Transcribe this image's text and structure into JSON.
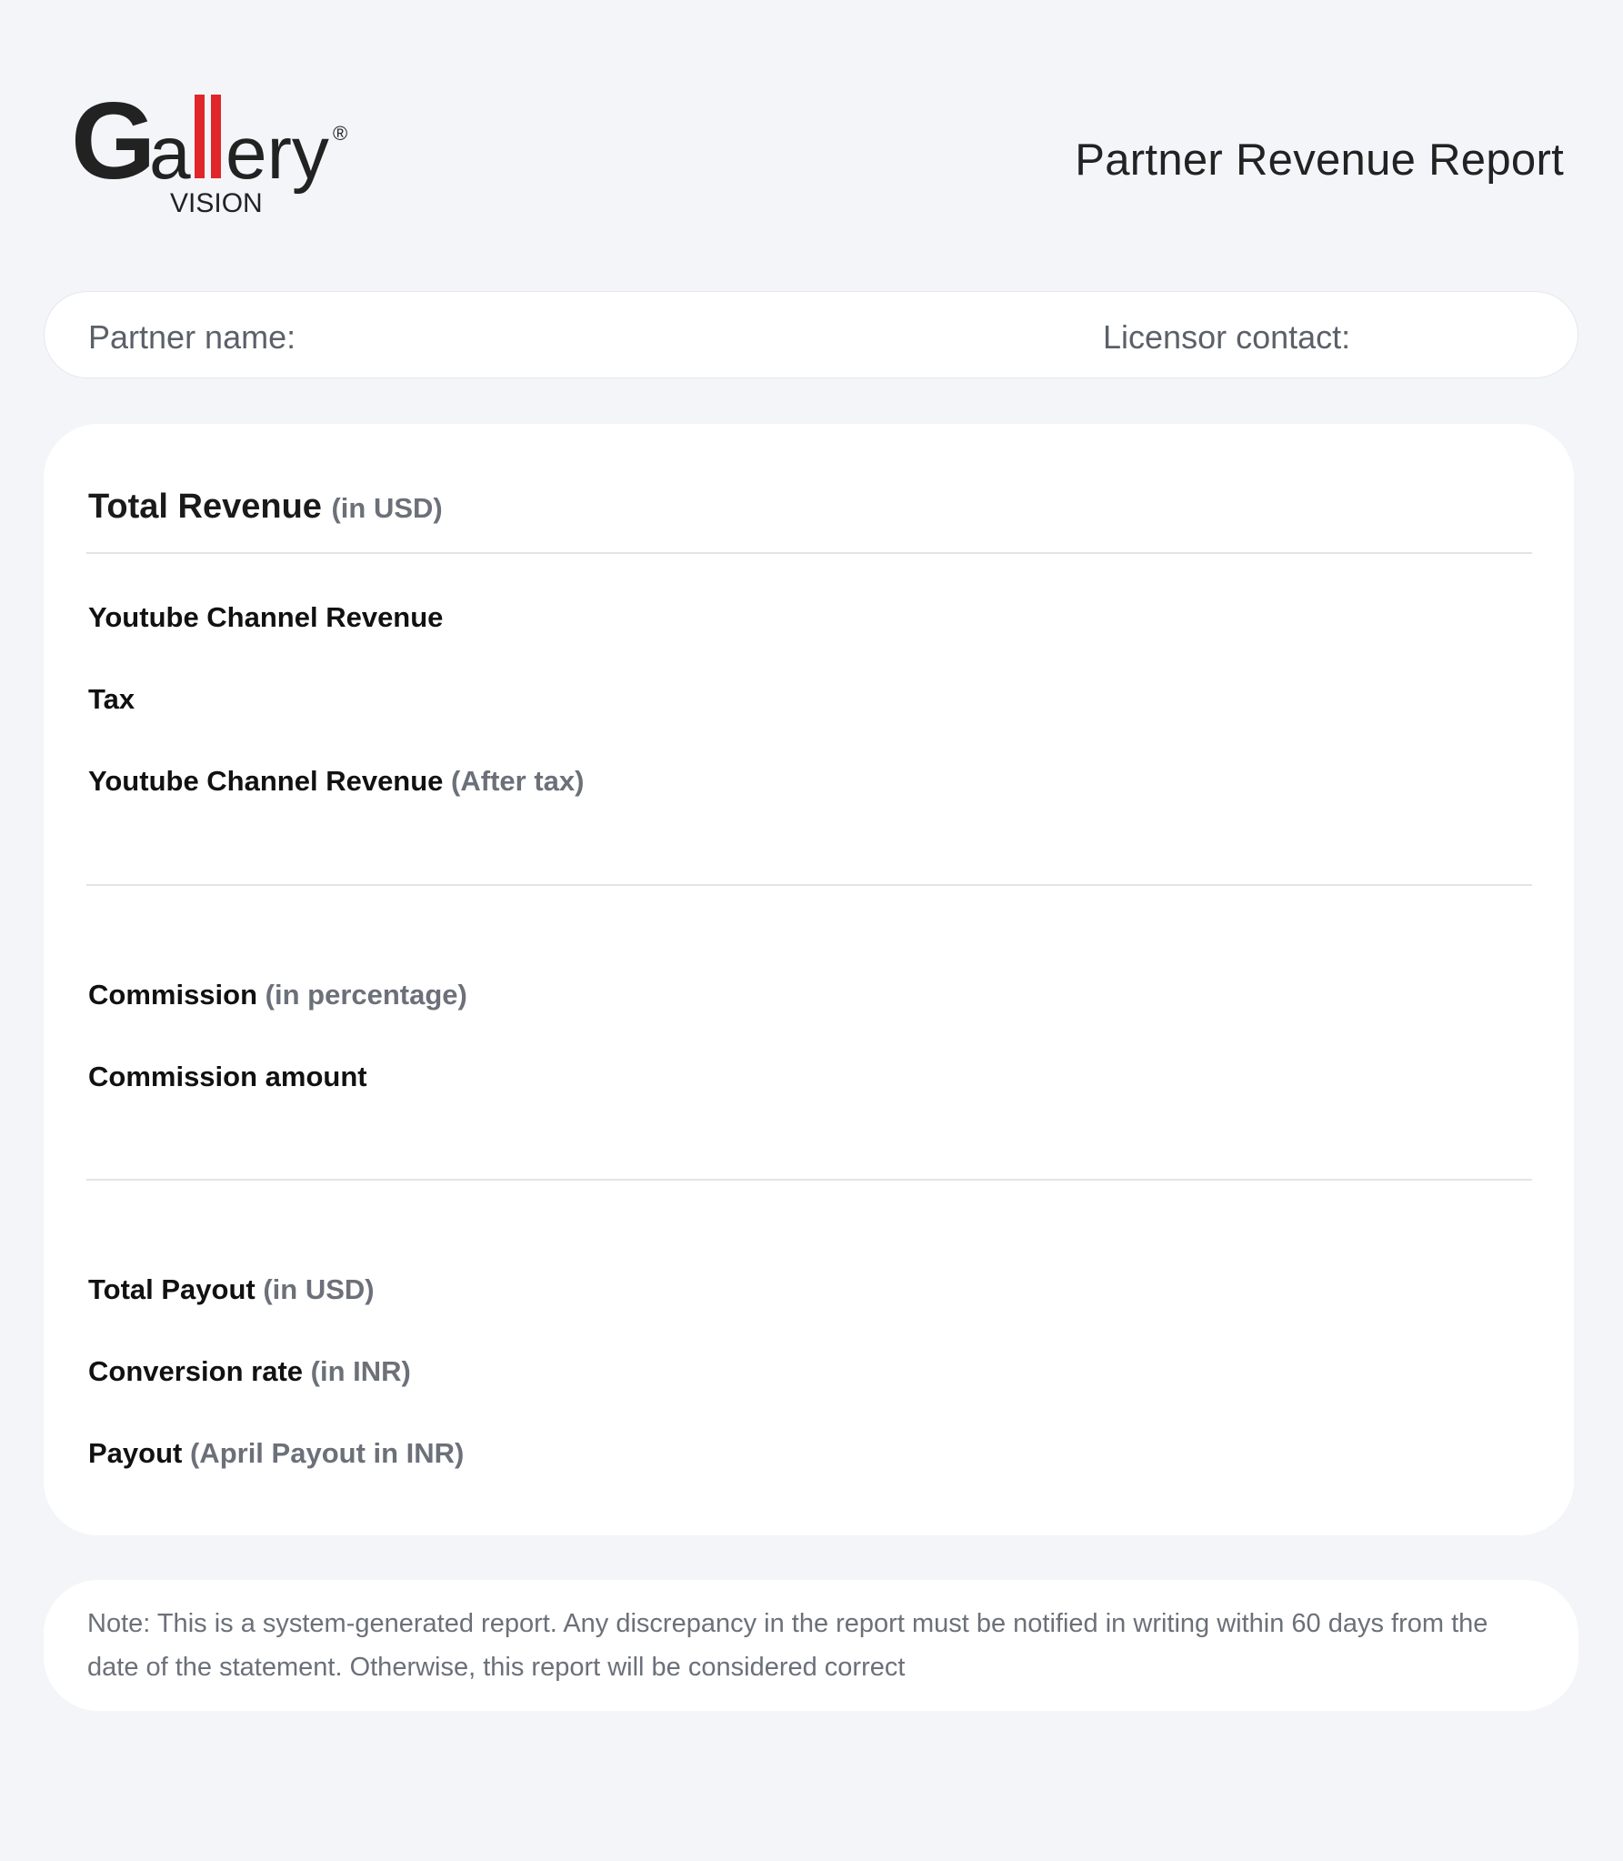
{
  "logo": {
    "wordmark": "Gallery",
    "registered": "®",
    "subtitle": "VISION",
    "colors": {
      "dark": "#222222",
      "accent": "#e0262b"
    }
  },
  "header": {
    "title": "Partner Revenue Report"
  },
  "info_bar": {
    "partner_label": "Partner name:",
    "licensor_label": "Licensor contact:"
  },
  "revenue_card": {
    "title": "Total Revenue",
    "title_unit": "(in USD)",
    "rows": [
      {
        "label": "Youtube Channel Revenue",
        "sub": ""
      },
      {
        "label": "Tax",
        "sub": ""
      },
      {
        "label": "Youtube Channel Revenue",
        "sub": "(After tax)"
      },
      {
        "label": "Commission",
        "sub": "(in percentage)"
      },
      {
        "label": "Commission amount",
        "sub": ""
      },
      {
        "label": "Total Payout",
        "sub": "(in USD)"
      },
      {
        "label": "Conversion rate",
        "sub": "(in INR)"
      },
      {
        "label": "Payout",
        "sub": "(April Payout in INR)"
      }
    ]
  },
  "note": {
    "text": "Note: This is a system-generated report. Any discrepancy in the report must be notified in writing within 60 days from the date of the statement. Otherwise, this report will be considered correct"
  }
}
